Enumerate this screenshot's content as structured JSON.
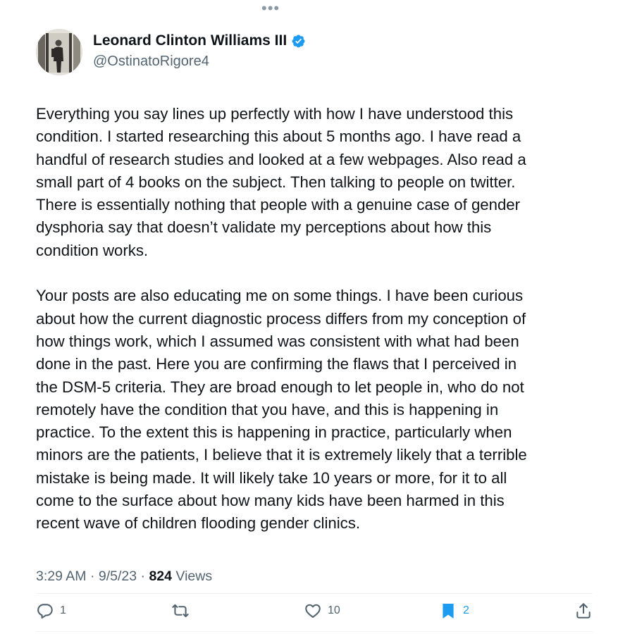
{
  "header": {
    "more_glyph": "•••"
  },
  "author": {
    "name": "Leonard Clinton Williams III",
    "handle": "@OstinatoRigore4",
    "verified": true
  },
  "tweet": {
    "paragraphs": [
      [
        "Everything you say lines up perfectly with how I have understood this",
        "condition. I started researching this about 5 months ago. I have read a",
        "handful of research studies and looked at a few webpages. Also read a",
        "small part of 4 books on the subject. Then talking to people on twitter.",
        "There is essentially nothing that people with a genuine case of gender",
        "dysphoria say that doesn’t validate my perceptions about how this",
        "condition works."
      ],
      [
        "Your posts are also educating me on some things. I have been curious",
        "about how the current diagnostic process differs from my conception of",
        "how things work, which I assumed was consistent with what had been",
        "done in the past. Here you are confirming the flaws that I perceived in",
        "the DSM-5 criteria. They are broad enough to let people in, who do not",
        "remotely have the condition that you have, and this is happening in",
        "practice. To the extent this is happening in practice, particularly when",
        "minors are the patients, I believe that it is extremely likely that a terrible",
        "mistake is being made. It will likely take 10 years or more, for it to all",
        "come to the surface about how many kids have been harmed in this",
        "recent wave of children flooding gender clinics."
      ]
    ]
  },
  "meta": {
    "time": "3:29 AM",
    "date": "9/5/23",
    "views_count": "824",
    "views_label": "Views"
  },
  "actions": {
    "reply_count": "1",
    "like_count": "10",
    "bookmark_count": "2"
  },
  "colors": {
    "accent": "#1d9bf0",
    "text": "#0f1419",
    "secondary": "#536471",
    "divider": "#eff3f4"
  }
}
